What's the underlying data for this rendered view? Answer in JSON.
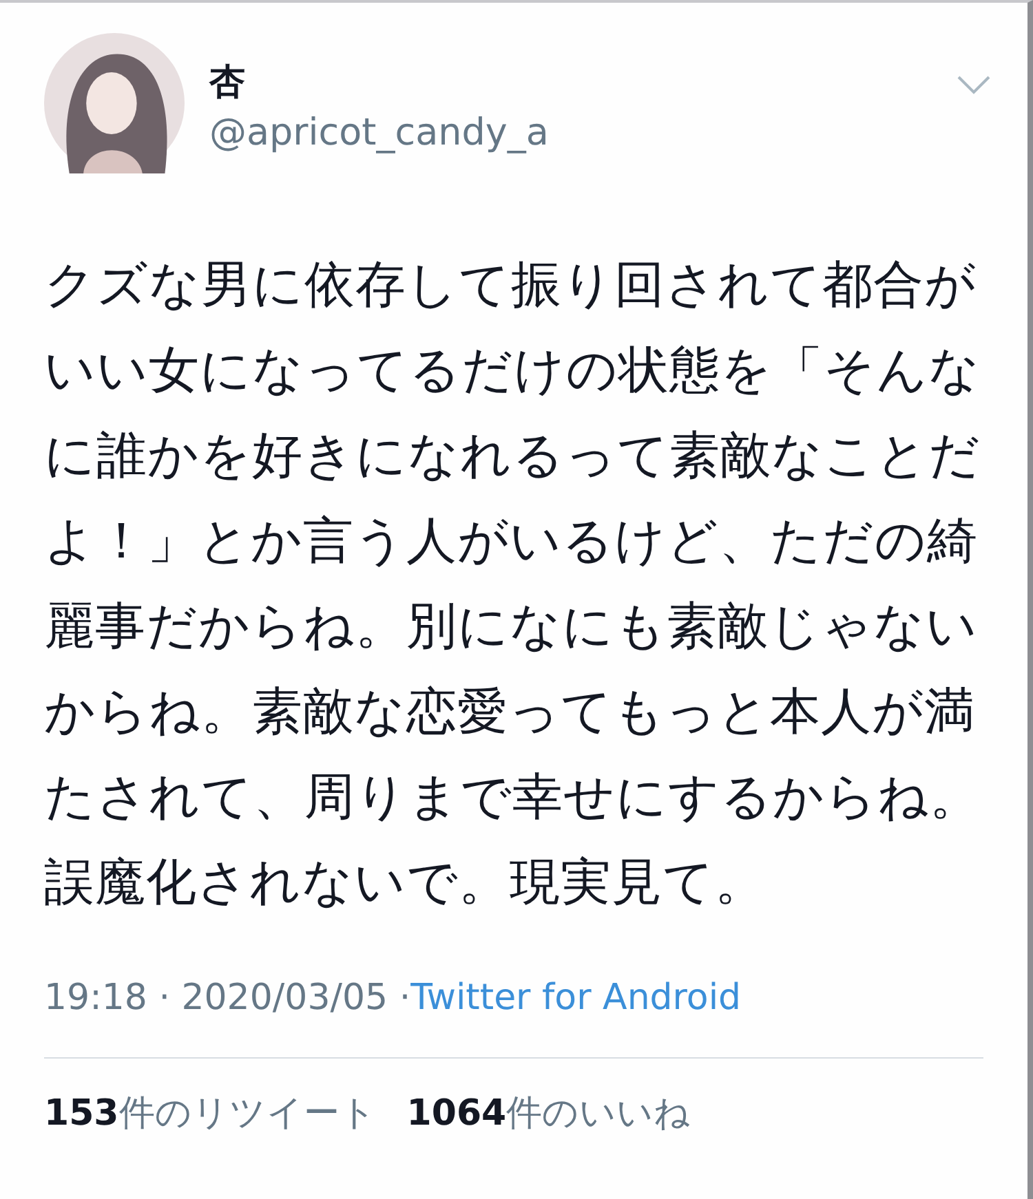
{
  "author": {
    "name": "杏",
    "handle": "@apricot_candy_a"
  },
  "body": "クズな男に依存して振り回されて都合がいい女になってるだけの状態を「そんなに誰かを好きになれるって素敵なことだよ！」とか言う人がいるけど、ただの綺麗事だからね。別になにも素敵じゃないからね。素敵な恋愛ってもっと本人が満たされて、周りまで幸せにするからね。誤魔化されないで。現実見て。",
  "timestamp": "19:18 · 2020/03/05 · ",
  "source": "Twitter for Android",
  "stats": [
    {
      "text": "**153**件のリツイート"
    },
    {
      "text": "**1064**件のいいね"
    }
  ]
}
